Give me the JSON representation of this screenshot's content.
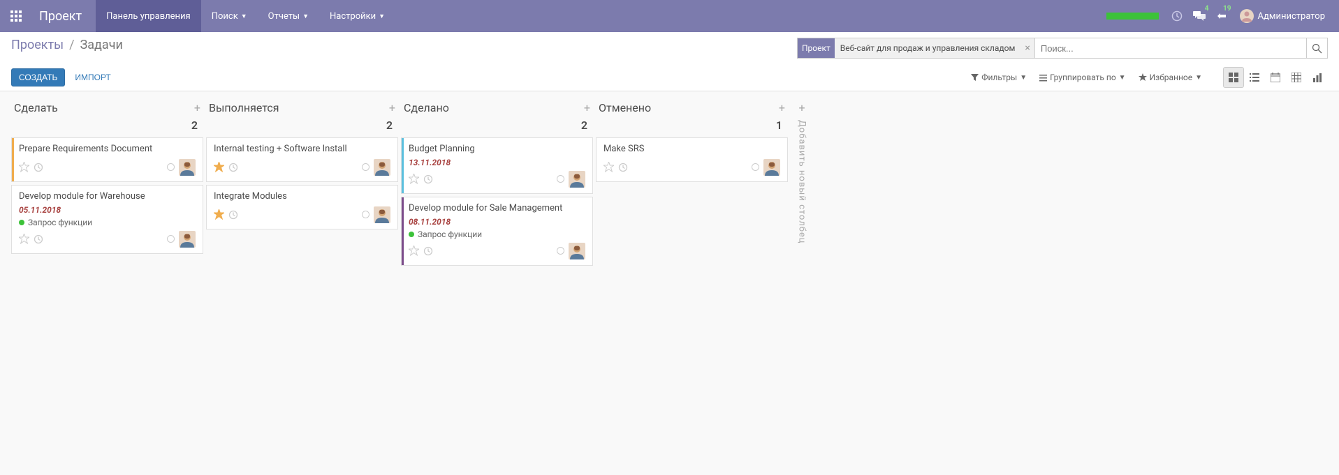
{
  "topbar": {
    "app_title": "Проект",
    "nav": [
      {
        "label": "Панель управления",
        "active": true,
        "dropdown": false
      },
      {
        "label": "Поиск",
        "active": false,
        "dropdown": true
      },
      {
        "label": "Отчеты",
        "active": false,
        "dropdown": true
      },
      {
        "label": "Настройки",
        "active": false,
        "dropdown": true
      }
    ],
    "messages_badge": "4",
    "notifications_badge": "19",
    "user_name": "Администратор"
  },
  "breadcrumb": {
    "parent": "Проекты",
    "current": "Задачи"
  },
  "search": {
    "facet_label": "Проект",
    "facet_value": "Веб-сайт для продаж и управления складом",
    "placeholder": "Поиск..."
  },
  "buttons": {
    "create": "СОЗДАТЬ",
    "import": "ИМПОРТ"
  },
  "filter_bar": {
    "filters": "Фильтры",
    "group_by": "Группировать по",
    "favorites": "Избранное"
  },
  "columns": [
    {
      "title": "Сделать",
      "count": "2",
      "cards": [
        {
          "title": "Prepare Requirements Document",
          "bar_color": "#f0ad4e",
          "date": "",
          "tag": "",
          "tag_color": "",
          "starred": false
        },
        {
          "title": "Develop module for Warehouse",
          "bar_color": "",
          "date": "05.11.2018",
          "tag": "Запрос функции",
          "tag_color": "#3cc239",
          "starred": false
        }
      ]
    },
    {
      "title": "Выполняется",
      "count": "2",
      "cards": [
        {
          "title": "Internal testing + Software Install",
          "bar_color": "",
          "date": "",
          "tag": "",
          "tag_color": "",
          "starred": true
        },
        {
          "title": "Integrate Modules",
          "bar_color": "",
          "date": "",
          "tag": "",
          "tag_color": "",
          "starred": true
        }
      ]
    },
    {
      "title": "Сделано",
      "count": "2",
      "cards": [
        {
          "title": "Budget Planning",
          "bar_color": "#5bc0de",
          "date": "13.11.2018",
          "tag": "",
          "tag_color": "",
          "starred": false
        },
        {
          "title": "Develop module for Sale Management",
          "bar_color": "#7c4d8b",
          "date": "08.11.2018",
          "tag": "Запрос функции",
          "tag_color": "#3cc239",
          "starred": false
        }
      ]
    },
    {
      "title": "Отменено",
      "count": "1",
      "cards": [
        {
          "title": "Make SRS",
          "bar_color": "",
          "date": "",
          "tag": "",
          "tag_color": "",
          "starred": false
        }
      ]
    }
  ],
  "add_column_label": "Добавить новый столбец"
}
